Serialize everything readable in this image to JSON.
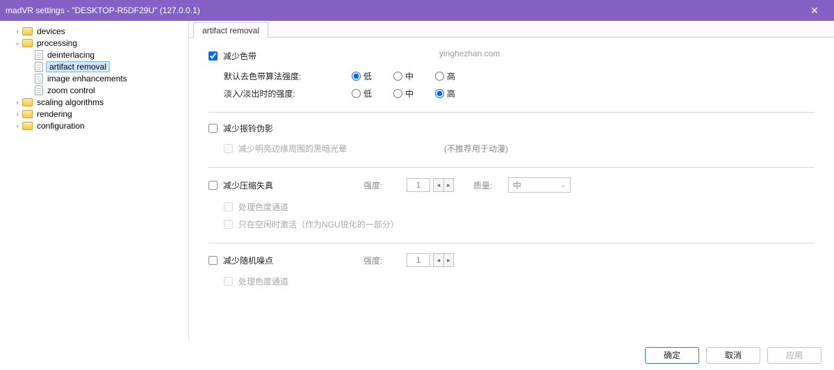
{
  "titlebar": {
    "title": "madVR settings - \"DESKTOP-R5DF29U\" (127.0.0.1)"
  },
  "tree": {
    "devices": "devices",
    "processing": "processing",
    "deinterlacing": "deinterlacing",
    "artifact_removal": "artifact removal",
    "image_enhancements": "image enhancements",
    "zoom_control": "zoom control",
    "scaling_algorithms": "scaling algorithms",
    "rendering": "rendering",
    "configuration": "configuration"
  },
  "tab": {
    "artifact_removal": "artifact removal"
  },
  "deband": {
    "label": "减少色带",
    "row1_label": "默认去色带算法强度:",
    "row2_label": "淡入/淡出时的强度:",
    "low": "低",
    "med": "中",
    "high": "高"
  },
  "dering": {
    "label": "减少振铃伪影",
    "sub1": "减少明亮边缘周围的黑暗光晕",
    "note": "(不推荐用于动漫)"
  },
  "decompress": {
    "label": "减少压缩失真",
    "strength_label": "强度:",
    "strength_value": "1",
    "quality_label": "质量:",
    "quality_value": "中",
    "sub1": "处理色度通道",
    "sub2": "只在空闲时激活（作为NGU锐化的一部分）"
  },
  "denoise": {
    "label": "减少随机噪点",
    "strength_label": "强度:",
    "strength_value": "1",
    "sub1": "处理色度通道"
  },
  "watermark": "yinghezhan.com",
  "footer": {
    "ok": "确定",
    "cancel": "取消",
    "apply": "应用"
  }
}
